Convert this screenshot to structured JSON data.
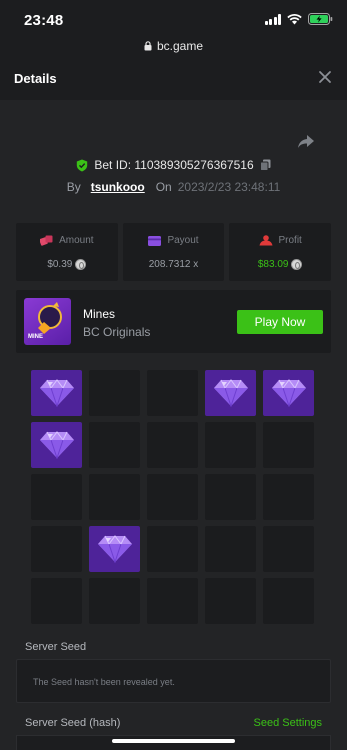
{
  "status_bar": {
    "time": "23:48"
  },
  "url_bar": {
    "domain": "bc.game"
  },
  "header": {
    "title": "Details"
  },
  "bet": {
    "id_label": "Bet ID: 110389305276367516",
    "by_label": "By",
    "username": "tsunkooo",
    "on_label": "On",
    "date": "2023/2/23 23:48:11"
  },
  "stats": {
    "amount": {
      "label": "Amount",
      "value": "$0.39"
    },
    "payout": {
      "label": "Payout",
      "value": "208.7312 x"
    },
    "profit": {
      "label": "Profit",
      "value": "$83.09"
    }
  },
  "game": {
    "name": "Mines",
    "provider": "BC Originals",
    "thumb_text": "MINE",
    "play_label": "Play Now"
  },
  "mines_grid": {
    "rows": 5,
    "cols": 5,
    "tiles": [
      "gem",
      "empty",
      "empty",
      "gem",
      "gem",
      "gem",
      "empty",
      "empty",
      "empty",
      "empty",
      "empty",
      "empty",
      "empty",
      "empty",
      "empty",
      "empty",
      "gem",
      "empty",
      "empty",
      "empty",
      "empty",
      "empty",
      "empty",
      "empty",
      "empty"
    ]
  },
  "server_seed": {
    "label": "Server Seed",
    "placeholder": "The Seed hasn't been revealed yet."
  },
  "server_seed_hash": {
    "label": "Server Seed (hash)",
    "settings_label": "Seed Settings"
  },
  "colors": {
    "accent_green": "#3bc117",
    "gem_tile": "#4e2399",
    "background": "#232426"
  }
}
